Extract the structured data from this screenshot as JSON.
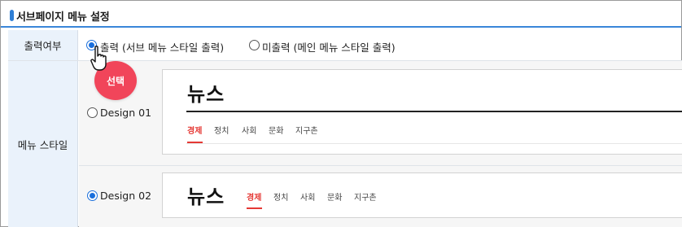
{
  "section": {
    "title": "서브페이지 메뉴 설정"
  },
  "output_row": {
    "label": "출력여부",
    "options": [
      {
        "label": "출력 (서브 메뉴 스타일 출력)",
        "checked": true
      },
      {
        "label": "미출력 (메인 메뉴 스타일 출력)",
        "checked": false
      }
    ]
  },
  "style_row": {
    "label": "메뉴 스타일",
    "selected_badge": "선택",
    "designs": [
      {
        "label": "Design 01",
        "checked": false,
        "preview": {
          "title": "뉴스",
          "nav": [
            "경제",
            "정치",
            "사회",
            "문화",
            "지구촌"
          ],
          "active": "경제"
        }
      },
      {
        "label": "Design 02",
        "checked": true,
        "preview": {
          "title": "뉴스",
          "nav": [
            "경제",
            "정치",
            "사회",
            "문화",
            "지구촌"
          ],
          "active": "경제"
        }
      }
    ]
  },
  "icons": {
    "cursor": "hand-pointer-icon",
    "section_marker": "section-marker-icon"
  },
  "colors": {
    "accent": "#2f7fd6",
    "badge": "#f1455a",
    "active_nav": "#e53935",
    "label_bg": "#eaf2fb"
  }
}
